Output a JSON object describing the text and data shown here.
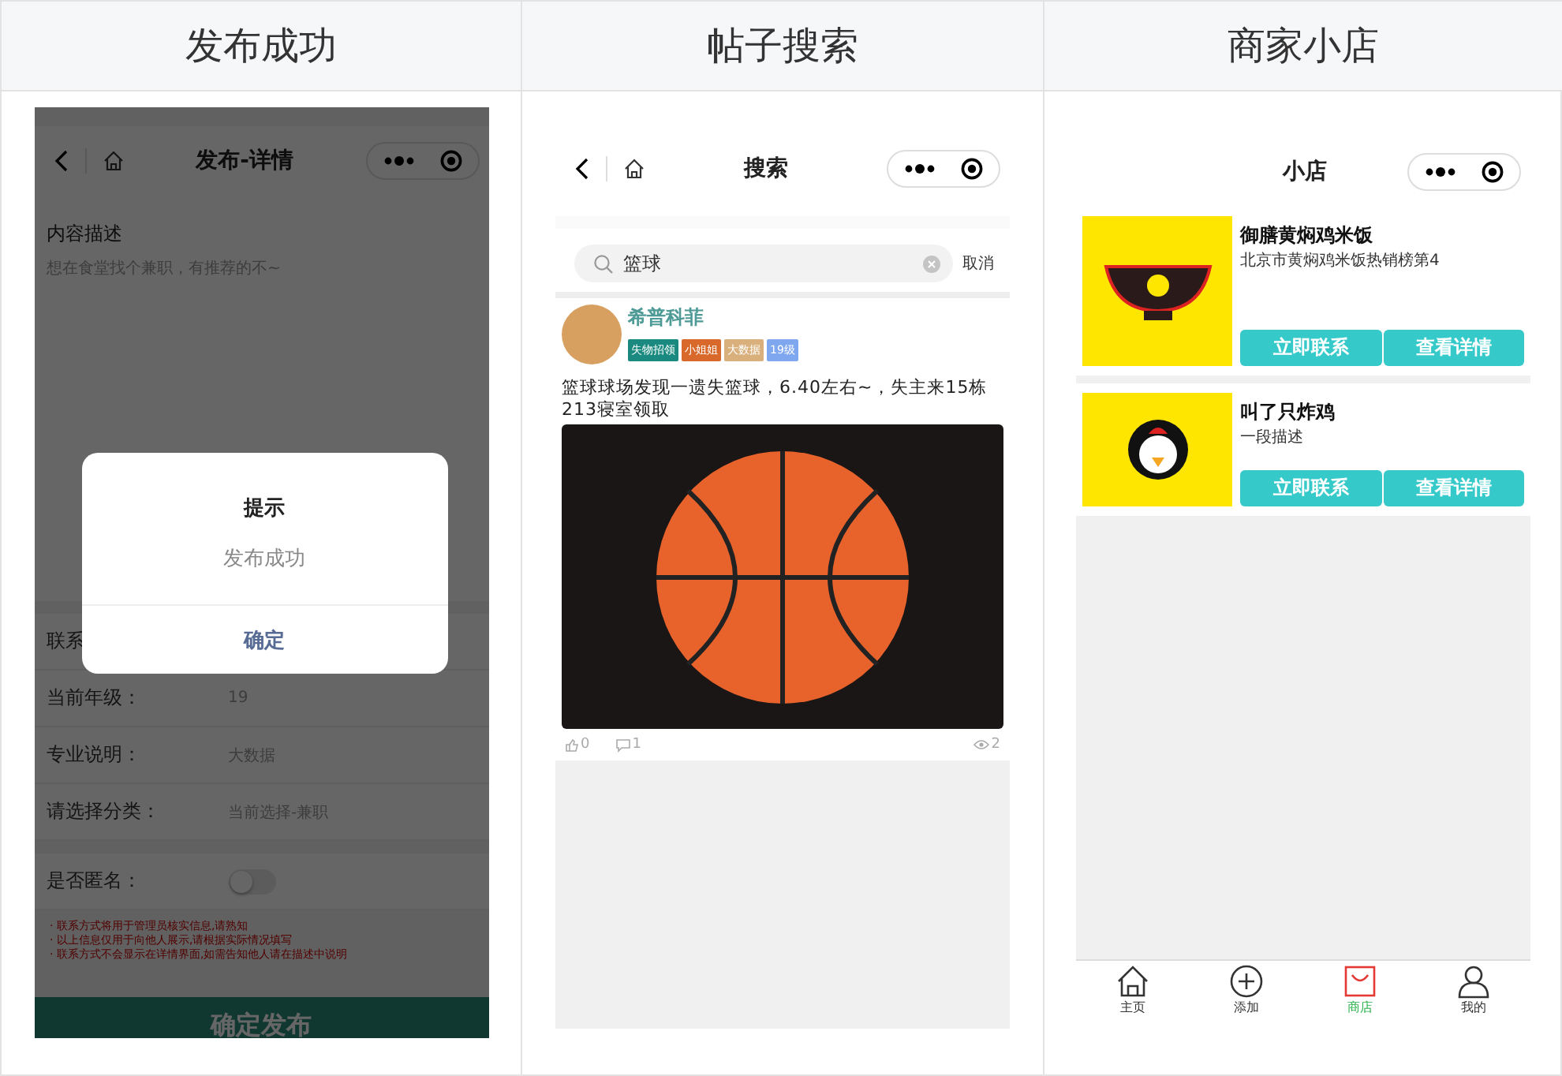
{
  "columns": [
    {
      "heading": "发布成功"
    },
    {
      "heading": "帖子搜索"
    },
    {
      "heading": "商家小店"
    }
  ],
  "publish_screen": {
    "nav_title": "发布-详情",
    "section_label": "内容描述",
    "description": "想在食堂找个兼职，有推荐的不~",
    "fields": [
      {
        "label": "联系"
      },
      {
        "label": "当前年级：",
        "value": "19"
      },
      {
        "label": "专业说明：",
        "value": "大数据"
      },
      {
        "label": "请选择分类：",
        "value": "当前选择-兼职"
      }
    ],
    "anonymous": {
      "label": "是否匿名：",
      "on": false
    },
    "notes": [
      "· 联系方式将用于管理员核实信息,请熟知",
      "· 以上信息仅用于向他人展示,请根据实际情况填写",
      "· 联系方式不会显示在详情界面,如需告知他人请在描述中说明"
    ],
    "submit": "确定发布",
    "dialog": {
      "title": "提示",
      "message": "发布成功",
      "confirm": "确定"
    }
  },
  "search_screen": {
    "nav_title": "搜索",
    "query": "篮球",
    "cancel": "取消",
    "post": {
      "author": "希普科菲",
      "tags": [
        {
          "label": "失物招领",
          "color": "#1a8a80"
        },
        {
          "label": "小姐姐",
          "color": "#d9692a"
        },
        {
          "label": "大数据",
          "color": "#d9b07c"
        },
        {
          "label": "19级",
          "color": "#7fa7f0"
        }
      ],
      "text": "篮球球场发现一遗失篮球，6.40左右~，失主来15栋213寝室领取",
      "likes": "0",
      "comments": "1",
      "views": "2"
    }
  },
  "shop_screen": {
    "nav_title": "小店",
    "shops": [
      {
        "kind": "bowl",
        "name": "御膳黄焖鸡米饭",
        "description": "北京市黄焖鸡米饭热销榜第4",
        "contact": "立即联系",
        "details": "查看详情"
      },
      {
        "kind": "chicken",
        "name": "叫了只炸鸡",
        "description": "一段描述",
        "contact": "立即联系",
        "details": "查看详情"
      }
    ],
    "tabbar": [
      {
        "kind": "home",
        "label": "主页",
        "selected": false
      },
      {
        "kind": "add",
        "label": "添加",
        "selected": false
      },
      {
        "kind": "shop",
        "label": "商店",
        "selected": true
      },
      {
        "kind": "user",
        "label": "我的",
        "selected": false
      }
    ]
  }
}
